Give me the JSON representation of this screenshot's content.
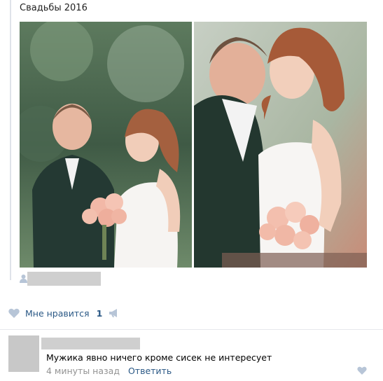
{
  "post": {
    "album_title": "Свадьбы 2016",
    "photos": [
      {
        "description_name": "wedding-couple-photo-1"
      },
      {
        "description_name": "wedding-couple-photo-2"
      }
    ]
  },
  "actions": {
    "like_label": "Мне нравится",
    "like_count": "1"
  },
  "comment": {
    "text": "Мужика явно ничего кроме сисек не интересует",
    "time": "4 минуты назад",
    "reply_label": "Ответить"
  },
  "colors": {
    "link": "#2a5885",
    "muted": "#939393",
    "icon": "#b7c5d7"
  }
}
